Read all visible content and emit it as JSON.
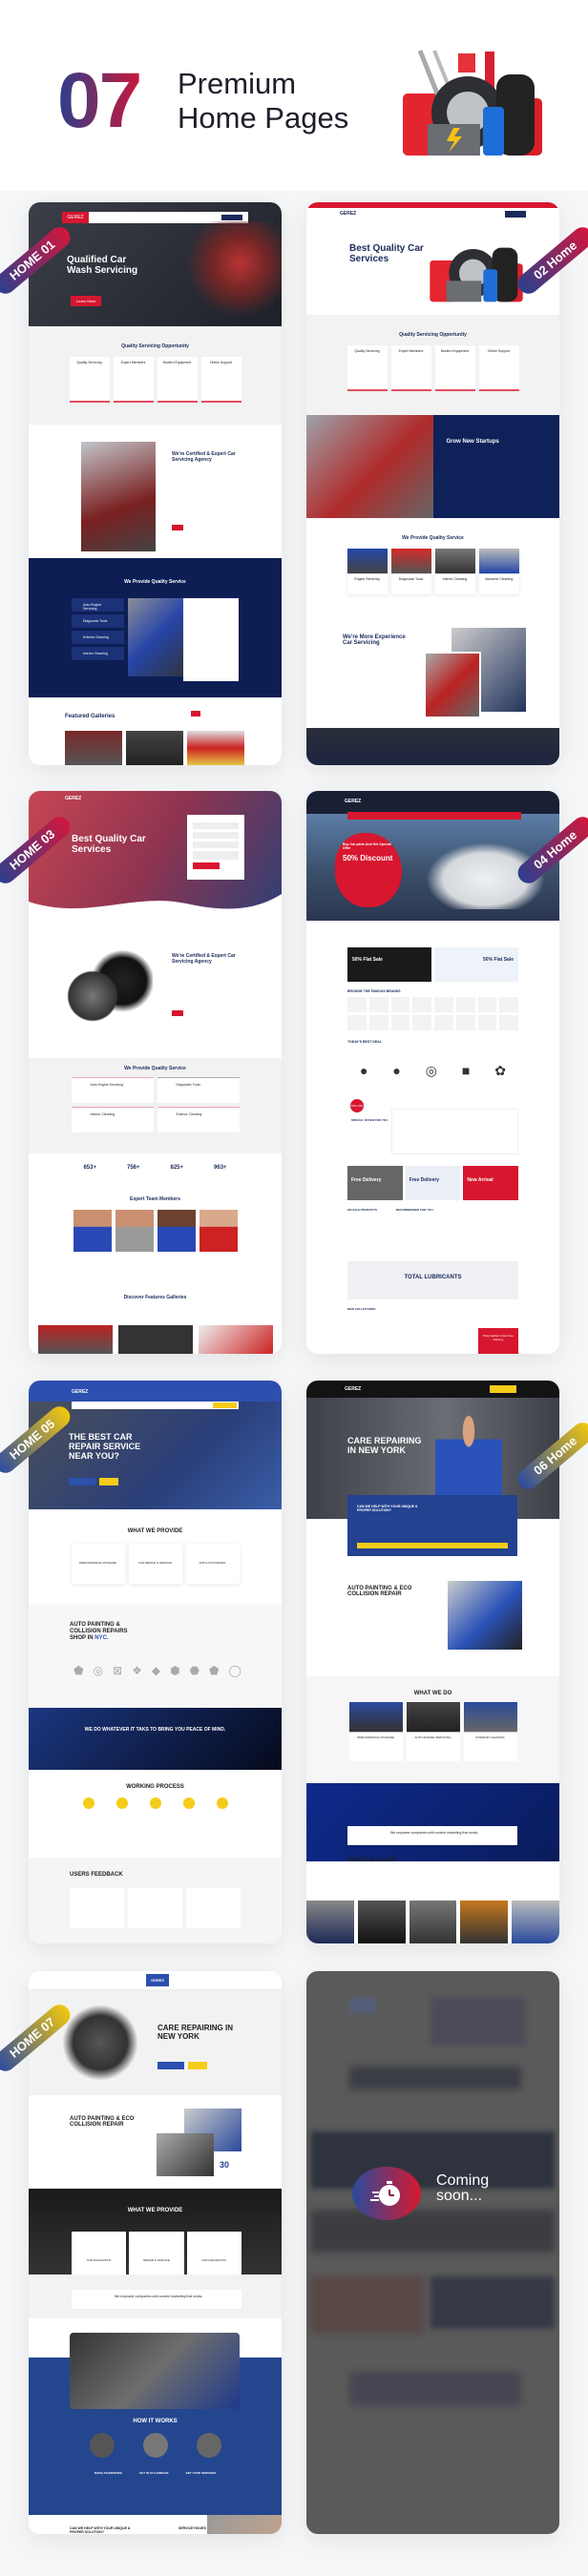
{
  "header": {
    "count": "07",
    "title_line1": "Premium",
    "title_line2": "Home Pages",
    "gradient_from": "#2b3f8c",
    "gradient_to": "#c8183a"
  },
  "brand": "GEREZ",
  "ribbons": [
    "HOME 01",
    "02 Home",
    "HOME 03",
    "04 Home",
    "HOME 05",
    "06 Home",
    "HOME 07"
  ],
  "home01": {
    "hero_title": "Qualified Car Wash Servicing",
    "button": "Learn More",
    "section1_title": "Quality Servicing Opportunity",
    "services": [
      "Quality Servicing",
      "Expert Members",
      "Modern Equipment",
      "Online Support"
    ],
    "about_title": "We're Certified & Expert Car Servicing Agency",
    "quality_title": "We Provide Quality Service",
    "quality_items": [
      "Auto Engine Servicing",
      "Diagnostic Tools",
      "Exterior Cleaning",
      "Interior Cleaning"
    ],
    "gallery_title": "Featured Galleries"
  },
  "home02": {
    "hero_title": "Best Quality Car Services",
    "section1_title": "Quality Servicing Opportunity",
    "services": [
      "Quality Servicing",
      "Expert Members",
      "Modern Equipment",
      "Online Support"
    ],
    "startups_title": "Grow New Startups",
    "quality_title": "We Provide Quality Service",
    "quality_items": [
      "Engine Servicing",
      "Diagnostic Tools",
      "Interior Cleaning",
      "Vacuume Cleaning"
    ],
    "experience_title": "We're More Experience Car Servicing"
  },
  "home03": {
    "hero_title": "Best Quality Car Services",
    "about_title": "We're Certified & Expert Car Servicing Agency",
    "quality_title": "We Provide Quality Service",
    "quality_items": [
      "Auto Engine Servicing",
      "Diagnostic Tools",
      "Interior Cleaning",
      "Exterior Cleaning"
    ],
    "stats": [
      "653+",
      "756+",
      "825+",
      "963+"
    ],
    "team_title": "Expert Team Members",
    "gallery_title": "Discover Features Galleries"
  },
  "home04": {
    "hero_small": "Buy Car parts And Get Special Offer",
    "hero_title": "50% Discount",
    "promo1": "50% Flat Sale",
    "promo2": "50% Flat Sale",
    "brands_title": "BROWSE THE FAMOUS BRANDS",
    "deal_title": "TODAY'S BEST DEAL",
    "offer_badge": "50% OFF",
    "special_offer": "SPECIAL OFFER FOR YOU",
    "banners": [
      "Free Delivery",
      "Free Delivery",
      "New Arrival"
    ],
    "onsale": "ON SALE PRODUCTS",
    "recommended": "RECOMMENDED FOR YOU",
    "lubricants": "TOTAL LUBRICANTS",
    "new_collections": "NEW COLLECTIONS",
    "shop_earlier": "Shop Earlier & Get Free Delivery"
  },
  "home05": {
    "hero_title": "THE BEST CAR REPAIR SERVICE NEAR YOU?",
    "provide_title": "WHAT WE PROVIDE",
    "provide_items": [
      "PERFORMANCE UPGRADE",
      "CAR REPAIR & SERVICE",
      "ANTI-LOCK REPAIR"
    ],
    "about_title_a": "AUTO PAINTING & COLLISION REPAIRS SHOP IN ",
    "about_title_b": "NYC.",
    "banner_title": "WE DO WHATEVER IT TAKS TO BRING YOU PEACE OF MIND.",
    "process_title": "WORKING PROCESS",
    "feedback_title": "USERS FEEDBACK"
  },
  "home06": {
    "hero_title": "CARE REPAIRING IN NEW YORK",
    "help_title": "CAN WE HELP WITH YOUR UNIQUE & PROPER SOLUTION?",
    "about_title": "AUTO PAINTING & ECO COLLISION REPAIR",
    "whatwedo_title": "WHAT WE DO",
    "whatwedo_items": [
      "PERFORMANCE UPGRADE",
      "AUTO ENGINE SERVICING",
      "INTERIOR CLEANING"
    ],
    "cta_text": "We empower companies with content marketing that works.",
    "gallery_title": "PHOTO GALLARY"
  },
  "home07": {
    "hero_title": "CARE REPAIRING IN NEW YORK",
    "about_title": "AUTO PAINTING & ECO COLLISION REPAIR",
    "years": "30",
    "provide_title": "WHAT WE PROVIDE",
    "provide_items": [
      "CAR DIAGNOSTIC",
      "REPAIR & SERVICE",
      "CAR DIAGNOSTIC"
    ],
    "cta_text": "We empower companies with content marketing that works.",
    "how_title": "HOW IT WORKS",
    "how_items": [
      "MAKE AN BOOKING",
      "GET IN AT GARRAGE",
      "GET YOUR SERVICES"
    ],
    "help_title": "CAN WE HELP WITH YOUR UNIQUE & PROPER SOLUTION?",
    "hours_title": "SERVICE HOURS"
  },
  "coming_soon": {
    "label_line1": "Coming",
    "label_line2": "soon..."
  }
}
